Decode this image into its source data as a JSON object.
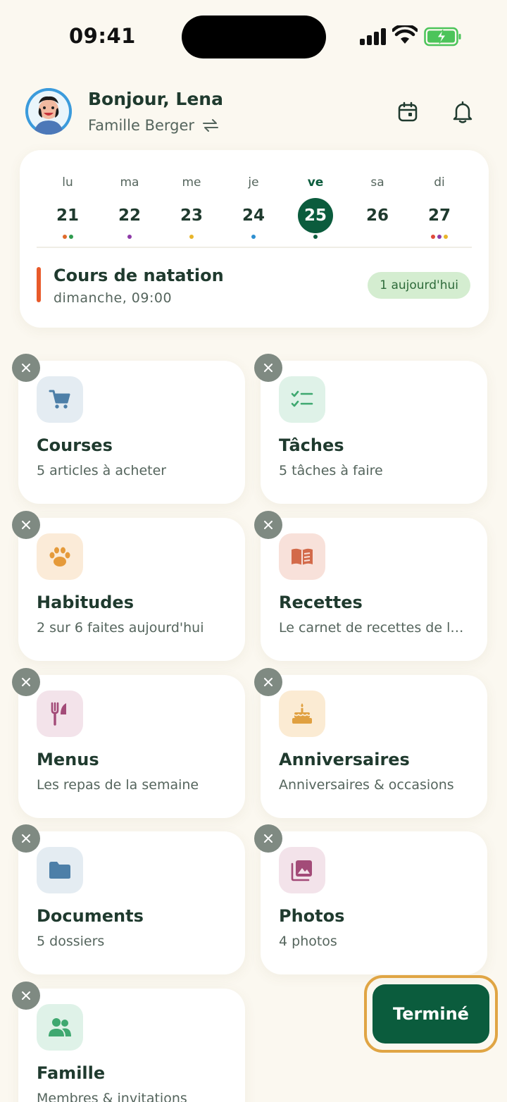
{
  "status": {
    "time": "09:41"
  },
  "header": {
    "greeting": "Bonjour, Lena",
    "family": "Famille Berger",
    "icons": [
      "avatar",
      "switch-icon",
      "calendar-icon",
      "bell-icon"
    ]
  },
  "calendar": {
    "days": [
      {
        "name": "lu",
        "num": "21",
        "dots": [
          "#E06A2B",
          "#2E9B4E"
        ]
      },
      {
        "name": "ma",
        "num": "22",
        "dots": [
          "#8E3AA8"
        ]
      },
      {
        "name": "me",
        "num": "23",
        "dots": [
          "#E8B52A"
        ]
      },
      {
        "name": "je",
        "num": "24",
        "dots": [
          "#2E8FD0"
        ]
      },
      {
        "name": "ve",
        "num": "25",
        "dots": [
          "#0B5C3D"
        ],
        "active": true
      },
      {
        "name": "sa",
        "num": "26",
        "dots": []
      },
      {
        "name": "di",
        "num": "27",
        "dots": [
          "#E04A3A",
          "#8E3AA8",
          "#E8B52A"
        ]
      }
    ],
    "event": {
      "title": "Cours de natation",
      "time": "dimanche, 09:00",
      "badge": "1 aujourd'hui",
      "color": "#E85A2A"
    }
  },
  "tiles": [
    {
      "title": "Courses",
      "subtitle": "5 articles à acheter",
      "icon": "cart-icon",
      "bg": "#E4ECF2",
      "fg": "#4D7FA8"
    },
    {
      "title": "Tâches",
      "subtitle": "5 tâches à faire",
      "icon": "checklist-icon",
      "bg": "#DFF2E8",
      "fg": "#3FA870"
    },
    {
      "title": "Habitudes",
      "subtitle": "2 sur 6 faites aujourd'hui",
      "icon": "paw-icon",
      "bg": "#FBEBD8",
      "fg": "#E59A3A"
    },
    {
      "title": "Recettes",
      "subtitle": "Le carnet de recettes de la famille",
      "icon": "recipe-book-icon",
      "bg": "#F8E1DA",
      "fg": "#D36A4A"
    },
    {
      "title": "Menus",
      "subtitle": "Les repas de la semaine",
      "icon": "cutlery-icon",
      "bg": "#F3E3EA",
      "fg": "#A34B78"
    },
    {
      "title": "Anniversaires",
      "subtitle": "Anniversaires & occasions",
      "icon": "cake-icon",
      "bg": "#FBEBD3",
      "fg": "#E0A040"
    },
    {
      "title": "Documents",
      "subtitle": "5 dossiers",
      "icon": "folder-icon",
      "bg": "#E4ECF2",
      "fg": "#4D7FA8"
    },
    {
      "title": "Photos",
      "subtitle": "4 photos",
      "icon": "photos-icon",
      "bg": "#F3E3EA",
      "fg": "#A34B78"
    },
    {
      "title": "Famille",
      "subtitle": "Membres & invitations",
      "icon": "people-icon",
      "bg": "#DFF2E8",
      "fg": "#3FA870"
    }
  ],
  "done_button": {
    "label": "Terminé"
  },
  "colors": {
    "primary": "#0B5C3D",
    "background": "#FBF8F0",
    "highlight": "#E0A544"
  }
}
